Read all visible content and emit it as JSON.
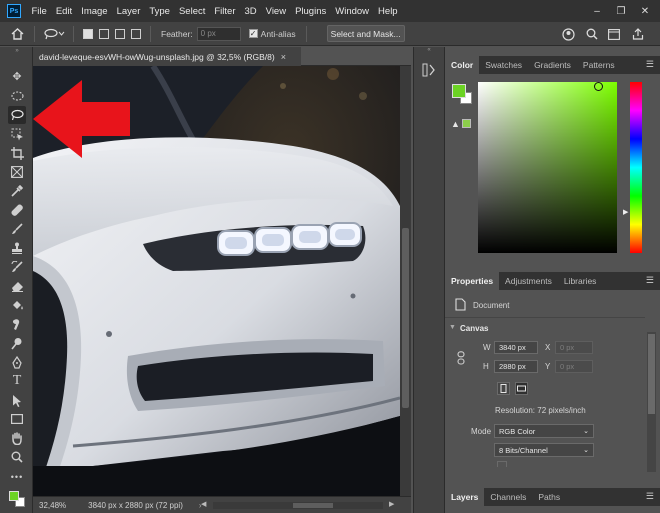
{
  "menubar": {
    "items": [
      "File",
      "Edit",
      "Image",
      "Layer",
      "Type",
      "Select",
      "Filter",
      "3D",
      "View",
      "Plugins",
      "Window",
      "Help"
    ],
    "logo": "Ps"
  },
  "options": {
    "feather_label": "Feather:",
    "feather_value": "0 px",
    "antialias_label": "Anti-alias",
    "antialias_checked": true,
    "select_mask_label": "Select and Mask..."
  },
  "document": {
    "tab_title": "david-leveque-esvWH-owWug-unsplash.jpg @ 32,5% (RGB/8)",
    "close_glyph": "×"
  },
  "status": {
    "zoom": "32,48%",
    "info": "3840 px x 2880 px (72 ppi)"
  },
  "color_panel": {
    "tabs": [
      "Color",
      "Swatches",
      "Gradients",
      "Patterns"
    ],
    "active_tab": "Color",
    "foreground": "#6cd324",
    "background": "#ffffff",
    "hue_color": "#7dff00"
  },
  "properties_panel": {
    "tabs": [
      "Properties",
      "Adjustments",
      "Libraries"
    ],
    "active_tab": "Properties",
    "document_label": "Document",
    "canvas_header": "Canvas",
    "w_label": "W",
    "w_value": "3840 px",
    "h_label": "H",
    "h_value": "2880 px",
    "x_label": "X",
    "x_placeholder": "0 px",
    "y_label": "Y",
    "y_placeholder": "0 px",
    "resolution": "Resolution: 72 pixels/inch",
    "mode_label": "Mode",
    "mode_value": "RGB Color",
    "depth_value": "8 Bits/Channel"
  },
  "layers_panel": {
    "tabs": [
      "Layers",
      "Channels",
      "Paths"
    ],
    "active_tab": "Layers"
  },
  "annotation": {
    "arrow_color": "#e8141b"
  }
}
